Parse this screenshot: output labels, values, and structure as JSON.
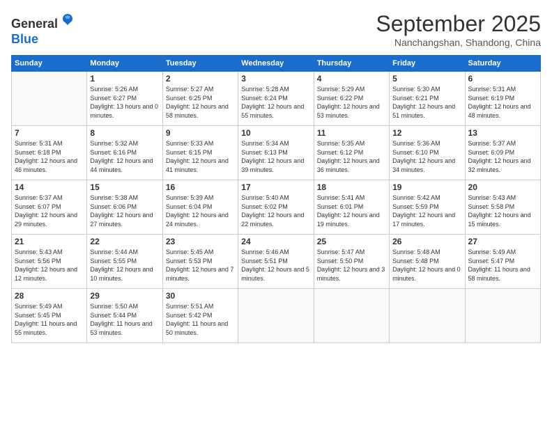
{
  "logo": {
    "general": "General",
    "blue": "Blue"
  },
  "header": {
    "month": "September 2025",
    "location": "Nanchangshan, Shandong, China"
  },
  "weekdays": [
    "Sunday",
    "Monday",
    "Tuesday",
    "Wednesday",
    "Thursday",
    "Friday",
    "Saturday"
  ],
  "weeks": [
    [
      {
        "day": "",
        "info": ""
      },
      {
        "day": "1",
        "info": "Sunrise: 5:26 AM\nSunset: 6:27 PM\nDaylight: 13 hours\nand 0 minutes."
      },
      {
        "day": "2",
        "info": "Sunrise: 5:27 AM\nSunset: 6:25 PM\nDaylight: 12 hours\nand 58 minutes."
      },
      {
        "day": "3",
        "info": "Sunrise: 5:28 AM\nSunset: 6:24 PM\nDaylight: 12 hours\nand 55 minutes."
      },
      {
        "day": "4",
        "info": "Sunrise: 5:29 AM\nSunset: 6:22 PM\nDaylight: 12 hours\nand 53 minutes."
      },
      {
        "day": "5",
        "info": "Sunrise: 5:30 AM\nSunset: 6:21 PM\nDaylight: 12 hours\nand 51 minutes."
      },
      {
        "day": "6",
        "info": "Sunrise: 5:31 AM\nSunset: 6:19 PM\nDaylight: 12 hours\nand 48 minutes."
      }
    ],
    [
      {
        "day": "7",
        "info": "Sunrise: 5:31 AM\nSunset: 6:18 PM\nDaylight: 12 hours\nand 46 minutes."
      },
      {
        "day": "8",
        "info": "Sunrise: 5:32 AM\nSunset: 6:16 PM\nDaylight: 12 hours\nand 44 minutes."
      },
      {
        "day": "9",
        "info": "Sunrise: 5:33 AM\nSunset: 6:15 PM\nDaylight: 12 hours\nand 41 minutes."
      },
      {
        "day": "10",
        "info": "Sunrise: 5:34 AM\nSunset: 6:13 PM\nDaylight: 12 hours\nand 39 minutes."
      },
      {
        "day": "11",
        "info": "Sunrise: 5:35 AM\nSunset: 6:12 PM\nDaylight: 12 hours\nand 36 minutes."
      },
      {
        "day": "12",
        "info": "Sunrise: 5:36 AM\nSunset: 6:10 PM\nDaylight: 12 hours\nand 34 minutes."
      },
      {
        "day": "13",
        "info": "Sunrise: 5:37 AM\nSunset: 6:09 PM\nDaylight: 12 hours\nand 32 minutes."
      }
    ],
    [
      {
        "day": "14",
        "info": "Sunrise: 5:37 AM\nSunset: 6:07 PM\nDaylight: 12 hours\nand 29 minutes."
      },
      {
        "day": "15",
        "info": "Sunrise: 5:38 AM\nSunset: 6:06 PM\nDaylight: 12 hours\nand 27 minutes."
      },
      {
        "day": "16",
        "info": "Sunrise: 5:39 AM\nSunset: 6:04 PM\nDaylight: 12 hours\nand 24 minutes."
      },
      {
        "day": "17",
        "info": "Sunrise: 5:40 AM\nSunset: 6:02 PM\nDaylight: 12 hours\nand 22 minutes."
      },
      {
        "day": "18",
        "info": "Sunrise: 5:41 AM\nSunset: 6:01 PM\nDaylight: 12 hours\nand 19 minutes."
      },
      {
        "day": "19",
        "info": "Sunrise: 5:42 AM\nSunset: 5:59 PM\nDaylight: 12 hours\nand 17 minutes."
      },
      {
        "day": "20",
        "info": "Sunrise: 5:43 AM\nSunset: 5:58 PM\nDaylight: 12 hours\nand 15 minutes."
      }
    ],
    [
      {
        "day": "21",
        "info": "Sunrise: 5:43 AM\nSunset: 5:56 PM\nDaylight: 12 hours\nand 12 minutes."
      },
      {
        "day": "22",
        "info": "Sunrise: 5:44 AM\nSunset: 5:55 PM\nDaylight: 12 hours\nand 10 minutes."
      },
      {
        "day": "23",
        "info": "Sunrise: 5:45 AM\nSunset: 5:53 PM\nDaylight: 12 hours\nand 7 minutes."
      },
      {
        "day": "24",
        "info": "Sunrise: 5:46 AM\nSunset: 5:51 PM\nDaylight: 12 hours\nand 5 minutes."
      },
      {
        "day": "25",
        "info": "Sunrise: 5:47 AM\nSunset: 5:50 PM\nDaylight: 12 hours\nand 3 minutes."
      },
      {
        "day": "26",
        "info": "Sunrise: 5:48 AM\nSunset: 5:48 PM\nDaylight: 12 hours\nand 0 minutes."
      },
      {
        "day": "27",
        "info": "Sunrise: 5:49 AM\nSunset: 5:47 PM\nDaylight: 11 hours\nand 58 minutes."
      }
    ],
    [
      {
        "day": "28",
        "info": "Sunrise: 5:49 AM\nSunset: 5:45 PM\nDaylight: 11 hours\nand 55 minutes."
      },
      {
        "day": "29",
        "info": "Sunrise: 5:50 AM\nSunset: 5:44 PM\nDaylight: 11 hours\nand 53 minutes."
      },
      {
        "day": "30",
        "info": "Sunrise: 5:51 AM\nSunset: 5:42 PM\nDaylight: 11 hours\nand 50 minutes."
      },
      {
        "day": "",
        "info": ""
      },
      {
        "day": "",
        "info": ""
      },
      {
        "day": "",
        "info": ""
      },
      {
        "day": "",
        "info": ""
      }
    ]
  ]
}
